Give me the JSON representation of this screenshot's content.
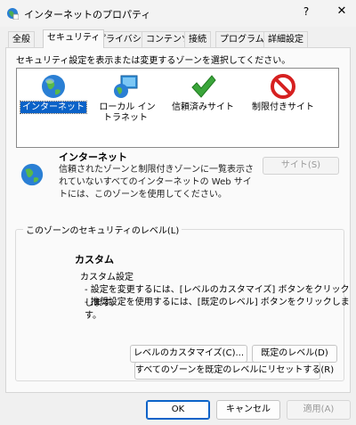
{
  "window": {
    "title": "インターネットのプロパティ",
    "help": "?",
    "close": "✕"
  },
  "tabs": [
    {
      "label": "全般"
    },
    {
      "label": "セキュリティ",
      "active": true
    },
    {
      "label": "プライバシー"
    },
    {
      "label": "コンテンツ"
    },
    {
      "label": "接続"
    },
    {
      "label": "プログラム"
    },
    {
      "label": "詳細設定"
    }
  ],
  "security": {
    "instruction": "セキュリティ設定を表示または変更するゾーンを選択してください。",
    "zones": [
      {
        "label": "インターネット",
        "icon": "globe-icon",
        "selected": true
      },
      {
        "label": "ローカル イントラネット",
        "icon": "intranet-icon"
      },
      {
        "label": "信頼済みサイト",
        "icon": "checkmark-icon"
      },
      {
        "label": "制限付きサイト",
        "icon": "restricted-icon"
      }
    ],
    "zone_info": {
      "name": "インターネット",
      "description": "信頼されたゾーンと制限付きゾーンに一覧表示されていないすべてのインターネットの Web サイトには、このゾーンを使用してください。",
      "sites_button": "サイト(S)"
    },
    "level_group": {
      "legend": "このゾーンのセキュリティのレベル(L)",
      "heading": "カスタム",
      "title": "カスタム設定",
      "line1": "- 設定を変更するには、[レベルのカスタマイズ] ボタンをクリックします。",
      "line2": "- 推奨設定を使用するには、[既定のレベル] ボタンをクリックします。",
      "customize_button": "レベルのカスタマイズ(C)...",
      "default_button": "既定のレベル(D)"
    },
    "reset_button": "すべてのゾーンを既定のレベルにリセットする(R)"
  },
  "footer": {
    "ok": "OK",
    "cancel": "キャンセル",
    "apply": "適用(A)"
  },
  "colors": {
    "selection": "#0a62c8",
    "globe": "#2a7fd4",
    "check": "#3aa53a",
    "restricted": "#d62020"
  }
}
